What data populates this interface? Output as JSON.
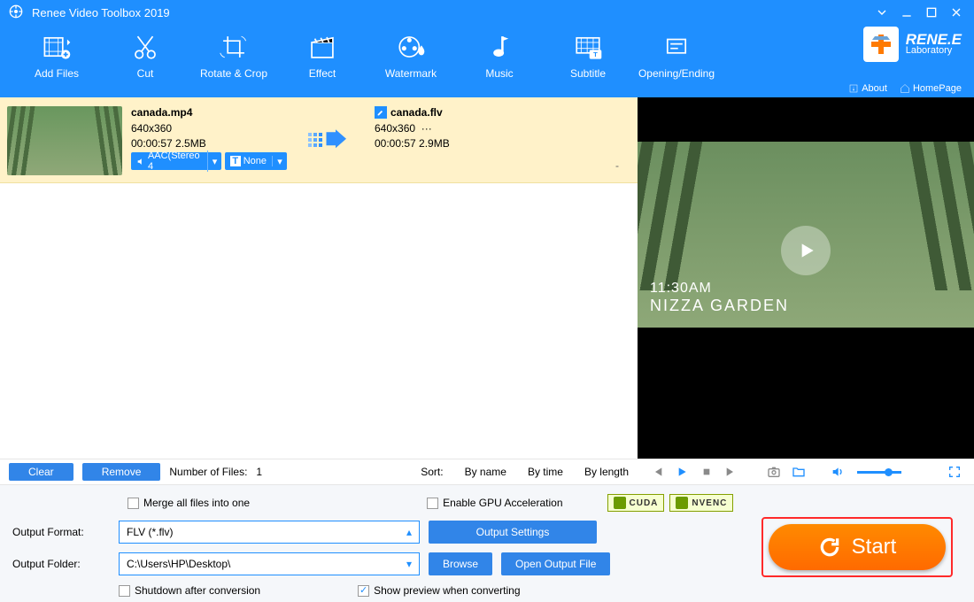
{
  "title": "Renee Video Toolbox 2019",
  "brand": {
    "name": "RENE.E",
    "sub": "Laboratory",
    "about": "About",
    "home": "HomePage"
  },
  "toolbar": [
    {
      "id": "add-files",
      "label": "Add Files"
    },
    {
      "id": "cut",
      "label": "Cut"
    },
    {
      "id": "rotate-crop",
      "label": "Rotate & Crop"
    },
    {
      "id": "effect",
      "label": "Effect"
    },
    {
      "id": "watermark",
      "label": "Watermark"
    },
    {
      "id": "music",
      "label": "Music"
    },
    {
      "id": "subtitle",
      "label": "Subtitle"
    },
    {
      "id": "opening-ending",
      "label": "Opening/Ending"
    }
  ],
  "row": {
    "src": {
      "name": "canada.mp4",
      "res": "640x360",
      "dur_size": "00:00:57  2.5MB",
      "audio": "AAC(Stereo 4",
      "sub": "None"
    },
    "dst": {
      "name": "canada.flv",
      "res": "640x360",
      "res_more": "···",
      "dur_size": "00:00:57  2.9MB"
    }
  },
  "preview": {
    "overlay_time": "11:30AM",
    "overlay_place": "NIZZA GARDEN"
  },
  "listbar": {
    "clear": "Clear",
    "remove": "Remove",
    "count_label": "Number of Files:",
    "count": "1",
    "sort_label": "Sort:",
    "by_name": "By name",
    "by_time": "By time",
    "by_length": "By length"
  },
  "bottom": {
    "merge": "Merge all files into one",
    "gpu": "Enable GPU Acceleration",
    "cuda": "CUDA",
    "nvenc": "NVENC",
    "fmt_label": "Output Format:",
    "fmt_value": "FLV (*.flv)",
    "settings": "Output Settings",
    "folder_label": "Output Folder:",
    "folder_value": "C:\\Users\\HP\\Desktop\\",
    "browse": "Browse",
    "open_out": "Open Output File",
    "shutdown": "Shutdown after conversion",
    "preview_chk": "Show preview when converting",
    "start": "Start"
  }
}
